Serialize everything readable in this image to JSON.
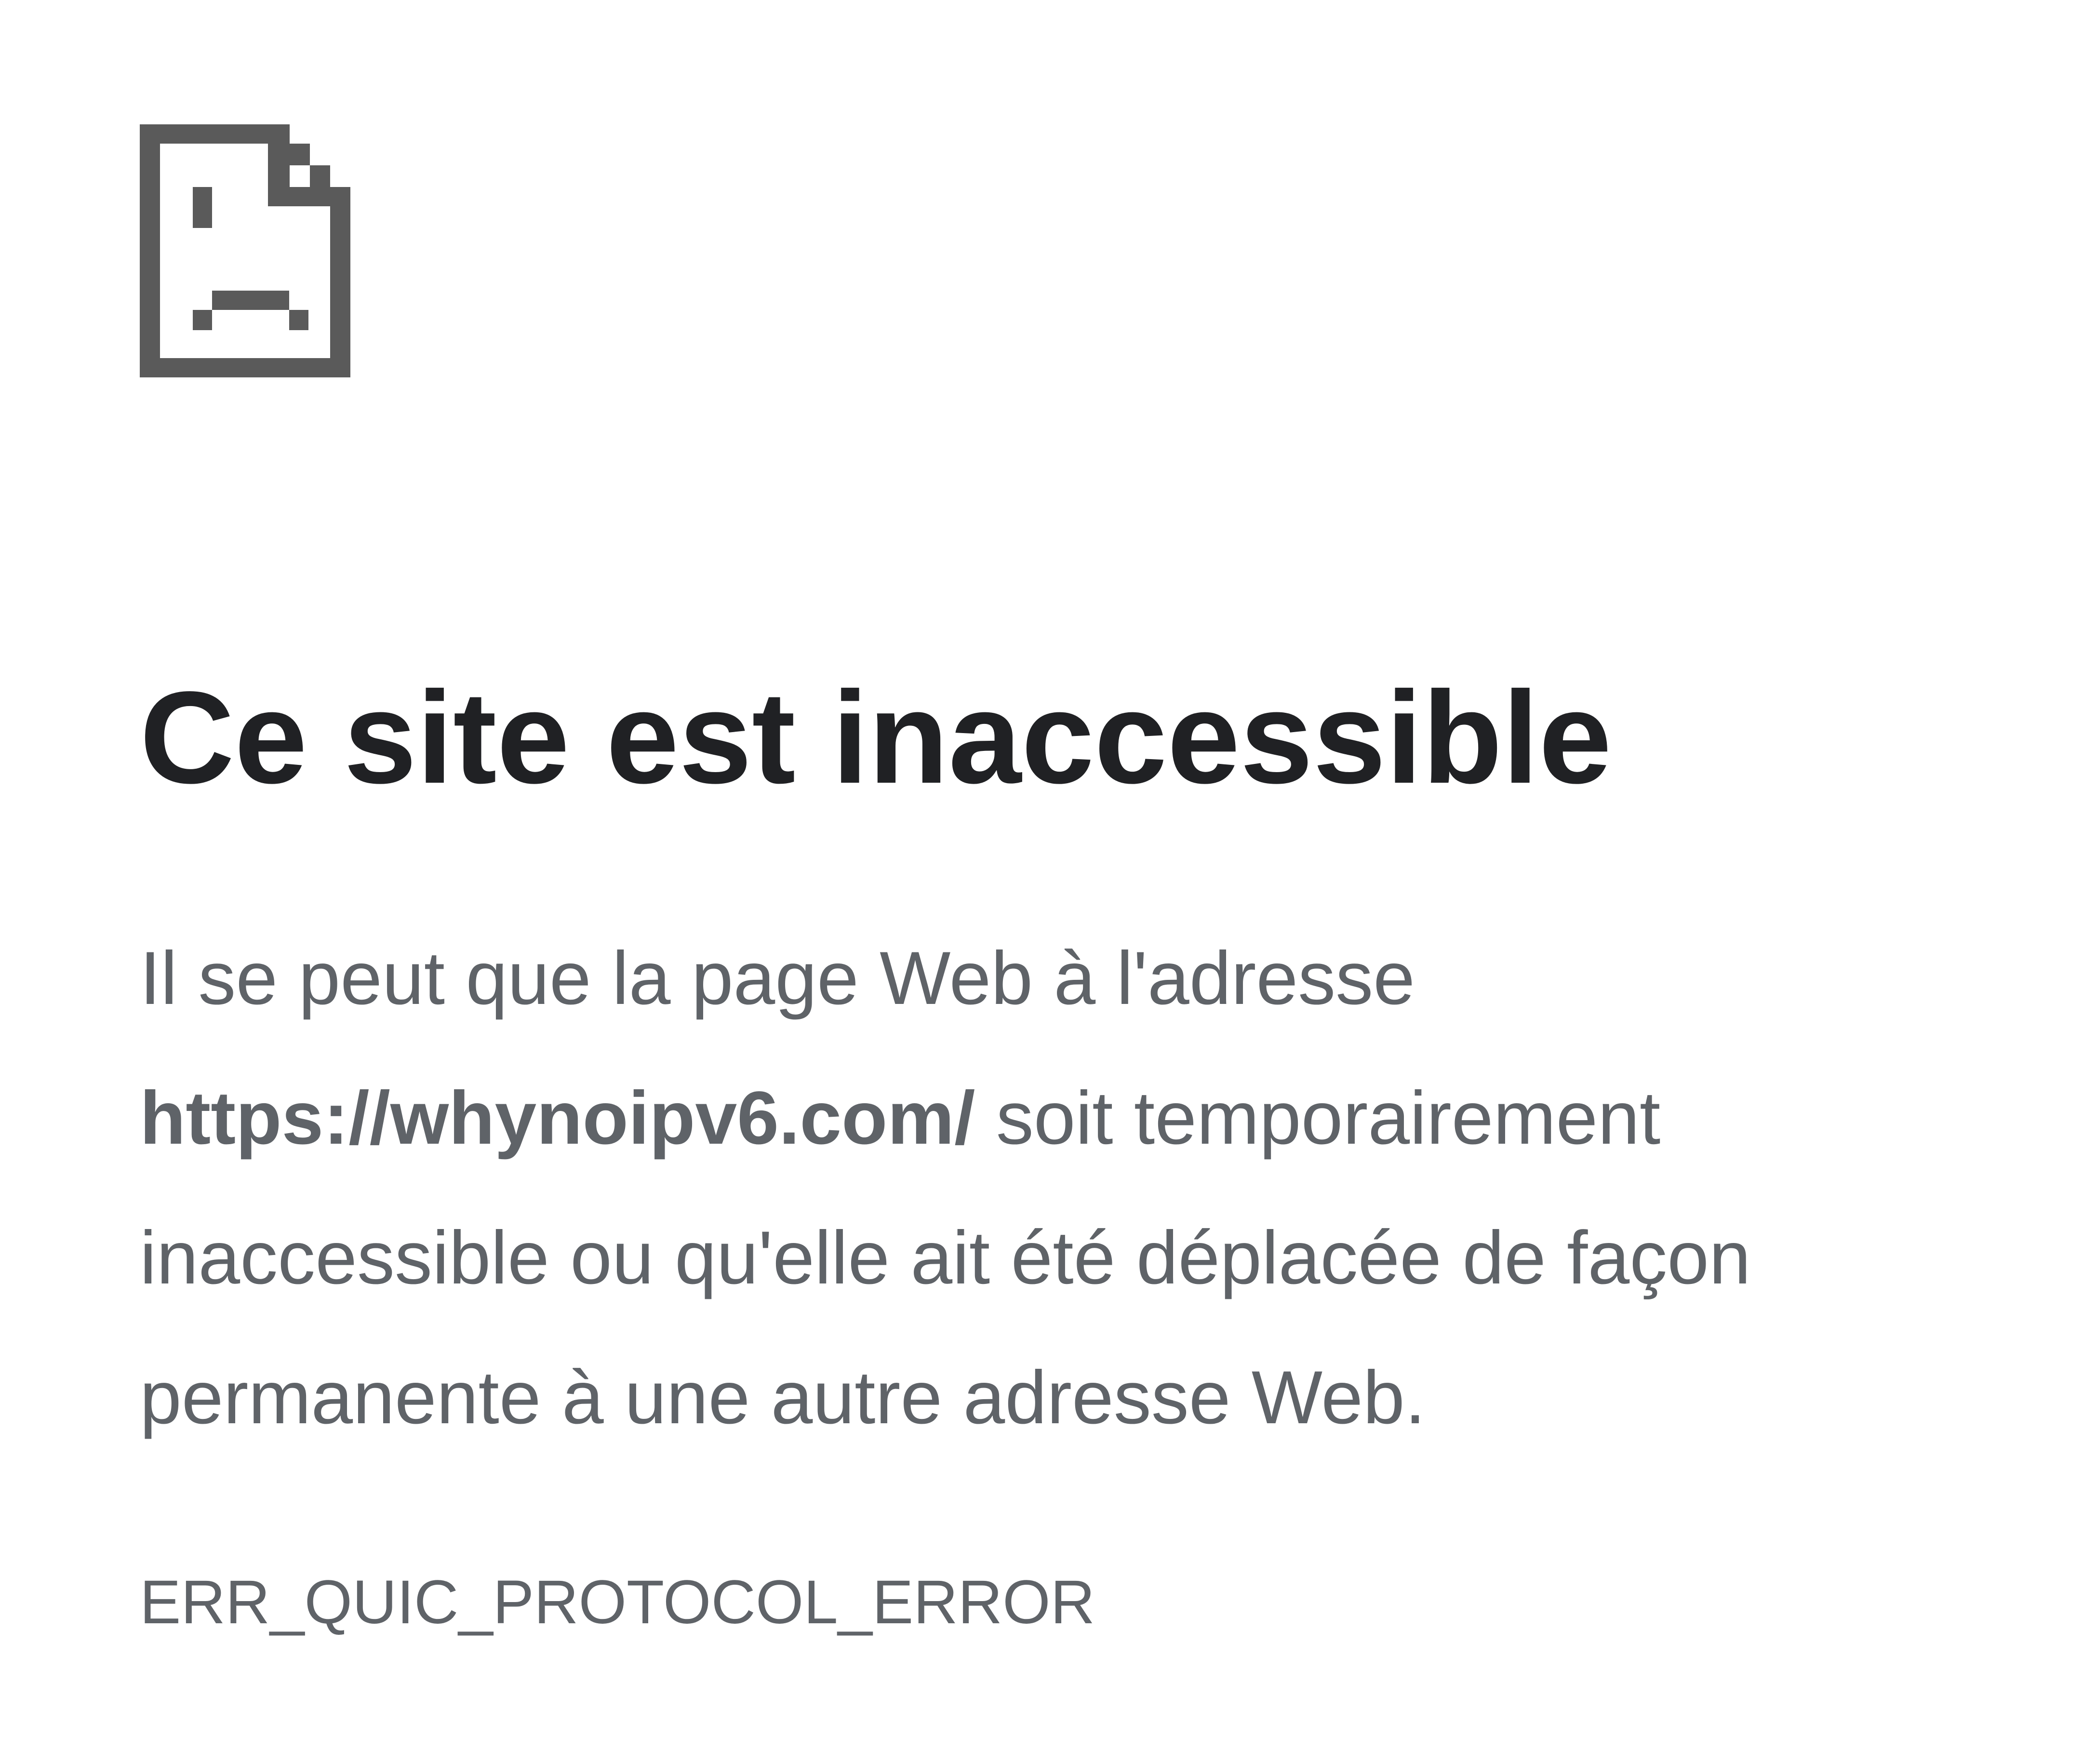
{
  "icon": {
    "name": "sad-page-icon",
    "color": "#5a5a5a"
  },
  "title": "Ce site est inaccessible",
  "message": {
    "line1": "Il se peut que la page Web à l'adresse",
    "url": "https://whynoipv6.com/",
    "line2_rest": " soit temporairement",
    "line3": "inaccessible ou qu'elle ait été déplacée de façon",
    "line4": "permanente à une autre adresse Web."
  },
  "error_code": "ERR_QUIC_PROTOCOL_ERROR",
  "colors": {
    "title": "#202124",
    "body_text": "#5f6368",
    "background": "#ffffff"
  }
}
